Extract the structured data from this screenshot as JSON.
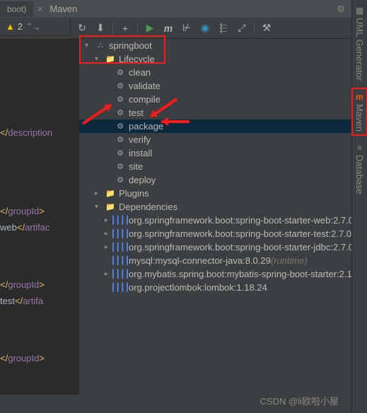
{
  "topTabs": {
    "tab1": "boot)",
    "chevron": "×",
    "title": "Maven"
  },
  "warnBar": {
    "count": "2"
  },
  "editor": {
    "lines": [
      "</descripti",
      "",
      "</groupId>",
      "web</artifac",
      "",
      "</groupId>",
      "test</artifa",
      "",
      "</groupId>"
    ]
  },
  "tree": {
    "root": {
      "label": "springboot"
    },
    "lifecycle": {
      "label": "Lifecycle",
      "items": [
        "clean",
        "validate",
        "compile",
        "test",
        "package",
        "verify",
        "install",
        "site",
        "deploy"
      ],
      "selectedIndex": 4
    },
    "plugins": {
      "label": "Plugins"
    },
    "deps": {
      "label": "Dependencies",
      "items": [
        {
          "label": "org.springframework.boot:spring-boot-starter-web:2.7.0",
          "expandable": true
        },
        {
          "label": "org.springframework.boot:spring-boot-starter-test:2.7.0",
          "expandable": true
        },
        {
          "label": "org.springframework.boot:spring-boot-starter-jdbc:2.7.0",
          "expandable": true
        },
        {
          "label": "mysql:mysql-connector-java:8.0.29",
          "scope": "(runtime)",
          "expandable": false
        },
        {
          "label": "org.mybatis.spring.boot:mybatis-spring-boot-starter:2.1",
          "expandable": true
        },
        {
          "label": "org.projectlombok:lombok:1.18.24",
          "expandable": false
        }
      ]
    }
  },
  "sideRail": {
    "uml": "UML Generator",
    "maven": "Maven",
    "db": "Database"
  },
  "watermark": "CSDN @li欧啦小屋"
}
